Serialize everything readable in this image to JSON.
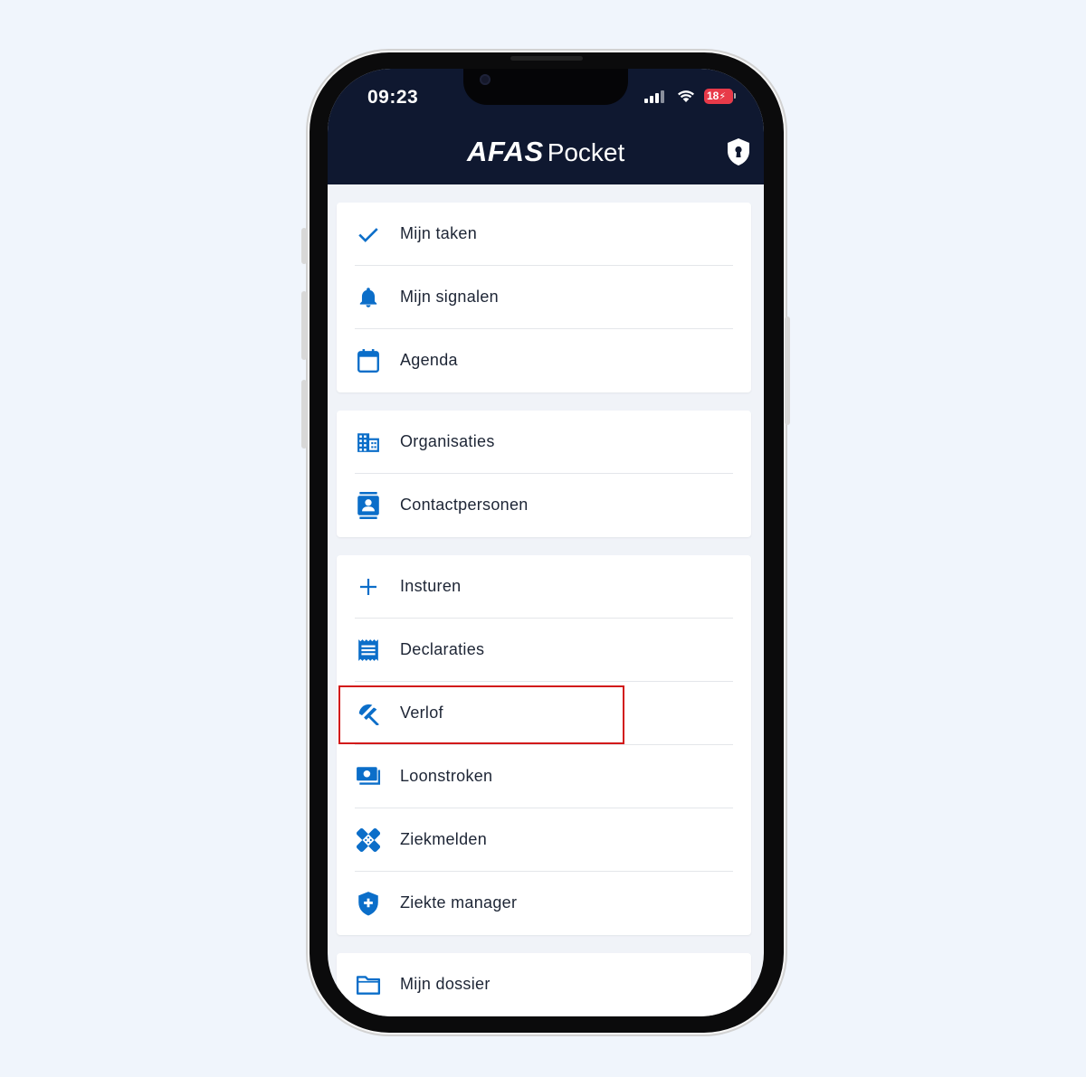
{
  "status_bar": {
    "time": "09:23",
    "battery": "18"
  },
  "header": {
    "brand": "AFAS",
    "product": "Pocket",
    "shield_icon": "shield-lock-icon"
  },
  "colors": {
    "header_bg": "#0f1830",
    "accent": "#0b6ec9",
    "highlight": "#d21a1a",
    "background": "#f0f5fc"
  },
  "menu": {
    "group1": [
      {
        "label": "Mijn taken",
        "icon": "check-icon"
      },
      {
        "label": "Mijn signalen",
        "icon": "bell-icon"
      },
      {
        "label": "Agenda",
        "icon": "calendar-icon"
      }
    ],
    "group2": [
      {
        "label": "Organisaties",
        "icon": "building-icon"
      },
      {
        "label": "Contactpersonen",
        "icon": "contact-card-icon"
      }
    ],
    "group3": [
      {
        "label": "Insturen",
        "icon": "plus-icon"
      },
      {
        "label": "Declaraties",
        "icon": "receipt-icon"
      },
      {
        "label": "Verlof",
        "icon": "beach-umbrella-icon"
      },
      {
        "label": "Loonstroken",
        "icon": "payslip-money-icon"
      },
      {
        "label": "Ziekmelden",
        "icon": "bandage-icon"
      },
      {
        "label": "Ziekte manager",
        "icon": "medical-shield-icon"
      }
    ],
    "group4": [
      {
        "label": "Mijn dossier",
        "icon": "folder-icon"
      }
    ]
  }
}
